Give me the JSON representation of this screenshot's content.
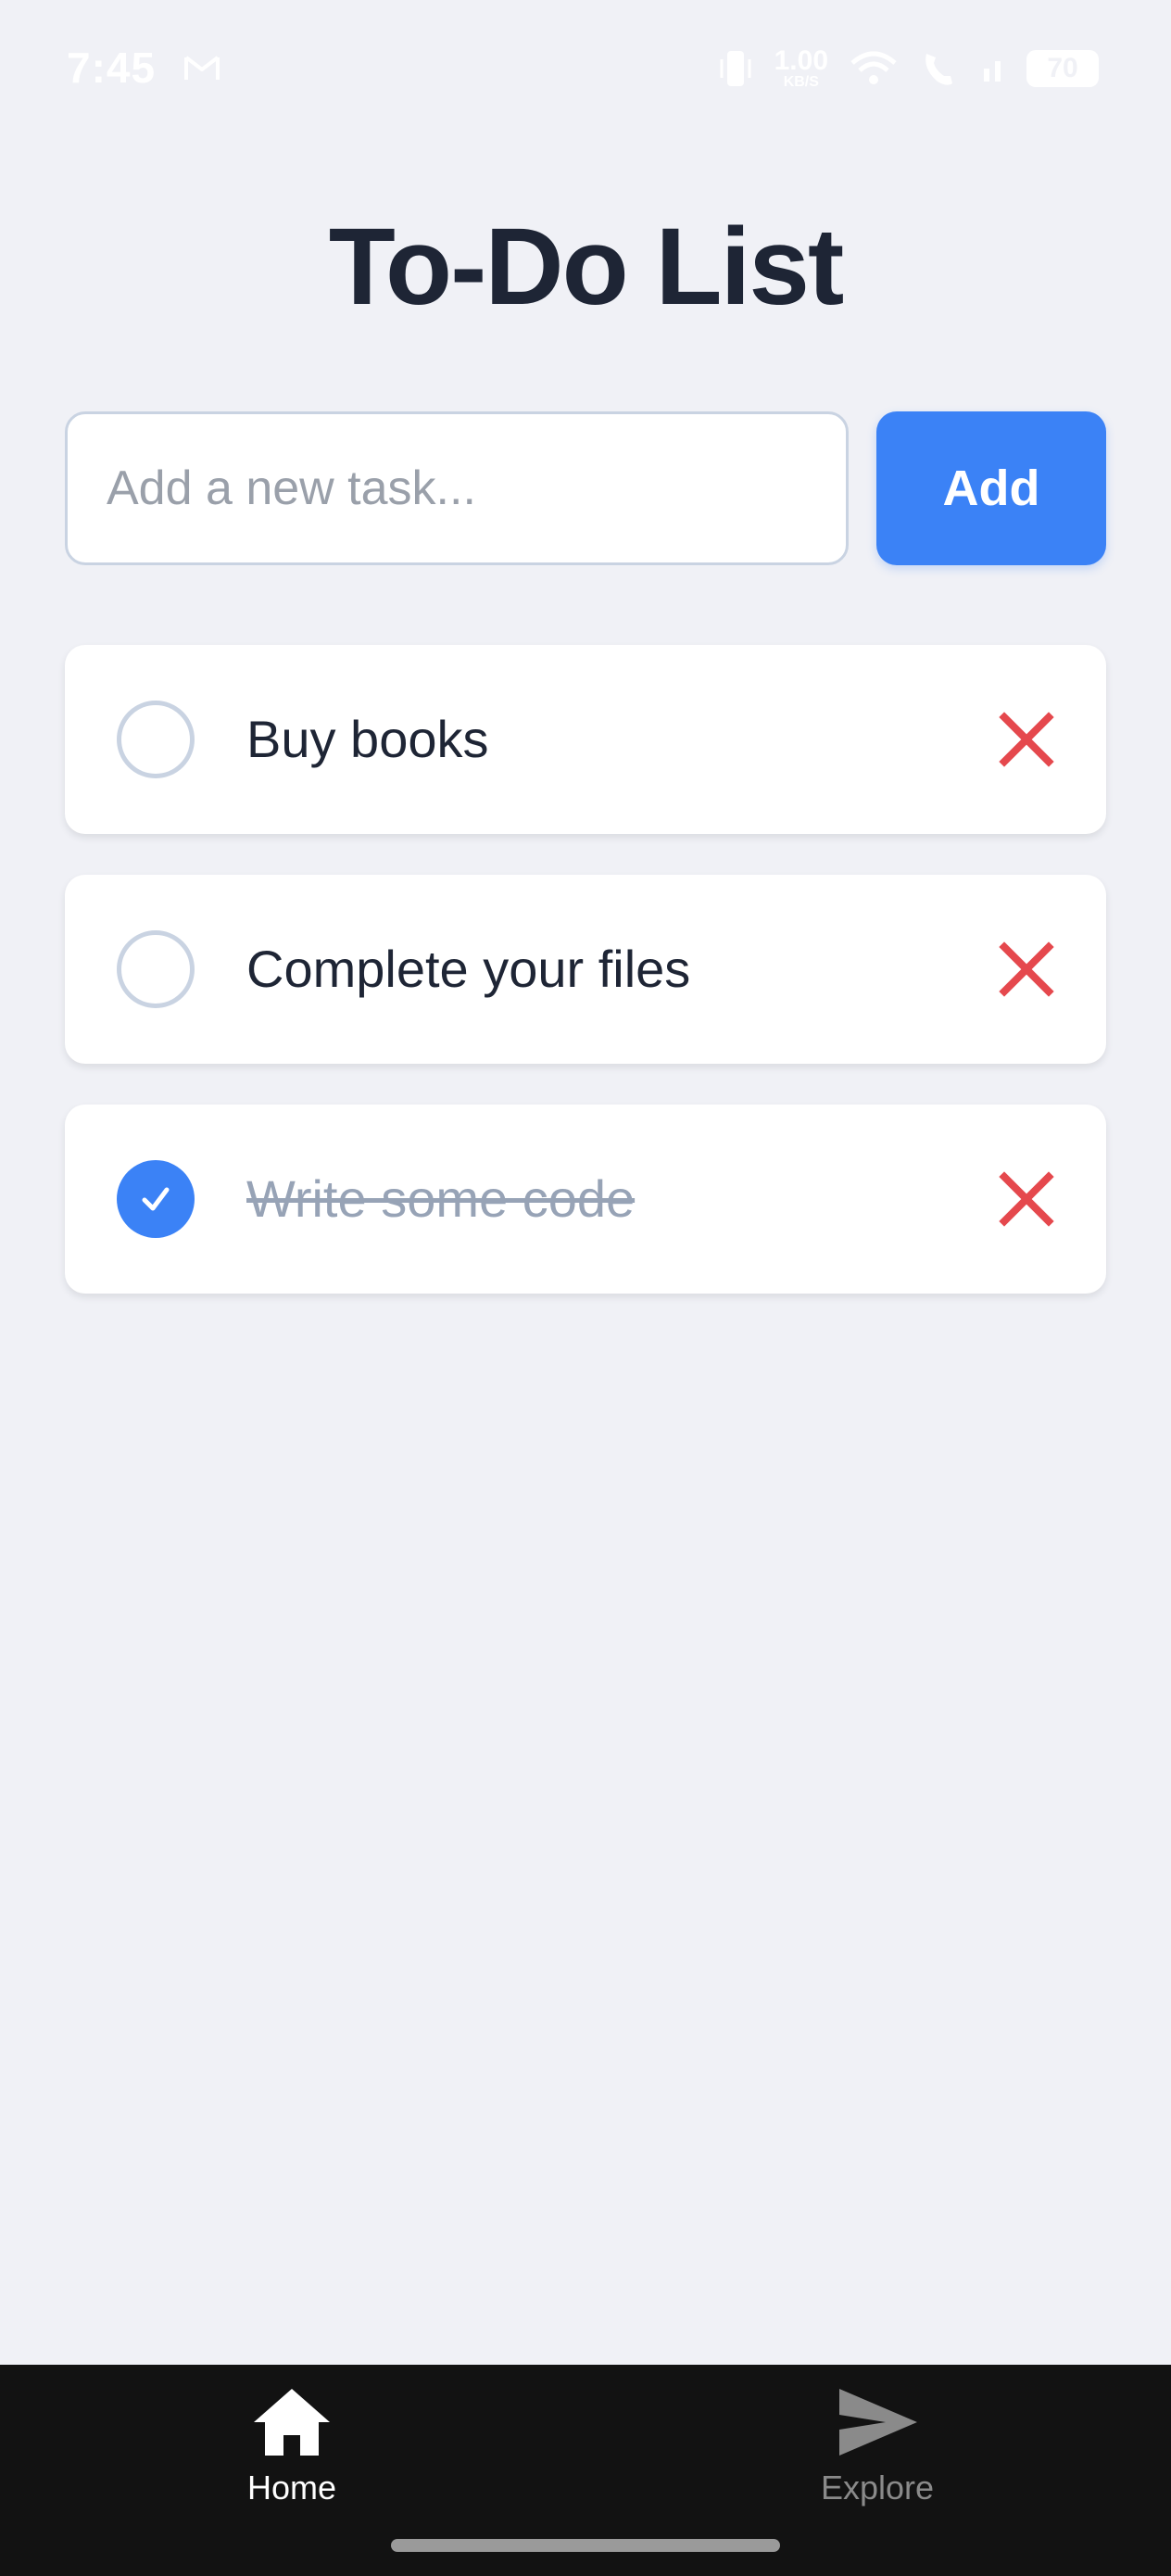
{
  "status_bar": {
    "time": "7:45",
    "net_speed_value": "1.00",
    "net_speed_unit": "KB/S",
    "battery": "70"
  },
  "page": {
    "title": "To-Do List"
  },
  "input": {
    "placeholder": "Add a new task...",
    "value": ""
  },
  "add_button": {
    "label": "Add"
  },
  "tasks": [
    {
      "label": "Buy books",
      "completed": false
    },
    {
      "label": "Complete your files",
      "completed": false
    },
    {
      "label": "Write some code",
      "completed": true
    }
  ],
  "bottom_nav": {
    "tabs": [
      {
        "label": "Home",
        "icon": "home-icon",
        "active": true
      },
      {
        "label": "Explore",
        "icon": "send-icon",
        "active": false
      }
    ]
  },
  "colors": {
    "accent": "#3b82f6",
    "delete": "#e5484d",
    "background": "#f0f1f6",
    "nav_background": "#121212"
  }
}
